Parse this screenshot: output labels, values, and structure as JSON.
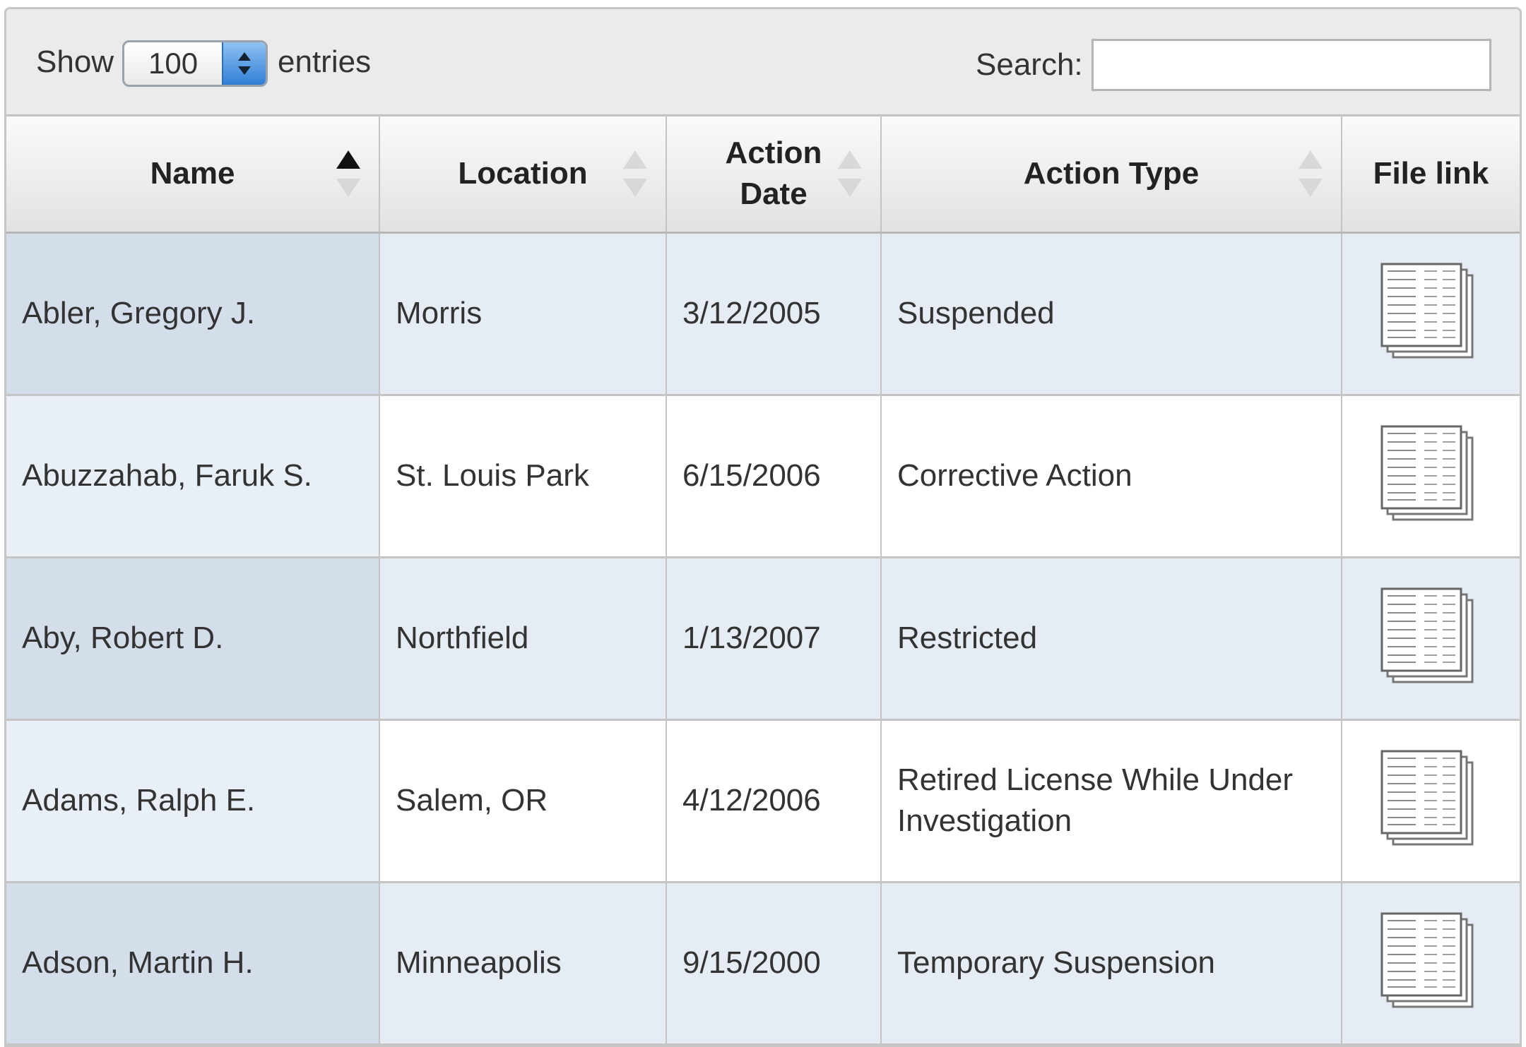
{
  "toolbar": {
    "show_label": "Show",
    "page_length": "100",
    "entries_label": "entries",
    "search_label": "Search:",
    "search_value": ""
  },
  "table": {
    "columns": [
      "Name",
      "Location",
      "Action Date",
      "Action Type",
      "File link"
    ],
    "sorted_column": "Name",
    "sort_direction": "ascending",
    "rows": [
      {
        "name": "Abler, Gregory J.",
        "location": "Morris",
        "date": "3/12/2005",
        "type": "Suspended",
        "file_icon": "document-stack-icon"
      },
      {
        "name": "Abuzzahab, Faruk S.",
        "location": "St. Louis Park",
        "date": "6/15/2006",
        "type": "Corrective Action",
        "file_icon": "document-stack-icon"
      },
      {
        "name": "Aby, Robert D.",
        "location": "Northfield",
        "date": "1/13/2007",
        "type": "Restricted",
        "file_icon": "document-stack-icon"
      },
      {
        "name": "Adams, Ralph E.",
        "location": "Salem, OR",
        "date": "4/12/2006",
        "type": "Retired License While Under Investigation",
        "file_icon": "document-stack-icon"
      },
      {
        "name": "Adson, Martin H.",
        "location": "Minneapolis",
        "date": "9/15/2000",
        "type": "Temporary Suspension",
        "file_icon": "document-stack-icon"
      }
    ]
  },
  "colors": {
    "odd_row": "#e6ecf4",
    "odd_row_sorted": "#d4deea",
    "even_row": "#ffffff",
    "even_row_sorted": "#e9eff7",
    "header_bg": "#e2e2e2",
    "select_accent": "#2f7fd6"
  }
}
